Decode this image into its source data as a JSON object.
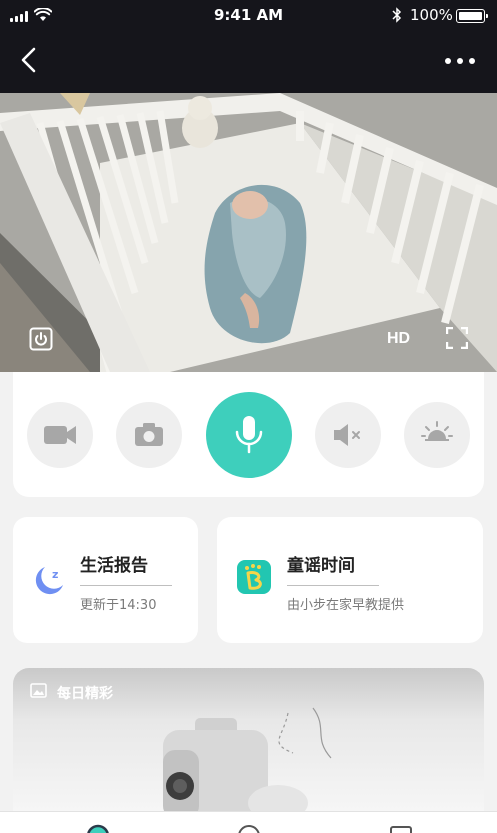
{
  "status_bar": {
    "time": "9:41 AM",
    "battery_text": "100%",
    "battery_level": 1.0,
    "icons": [
      "signal-icon",
      "wifi-icon",
      "bluetooth-icon",
      "battery-icon"
    ]
  },
  "nav": {
    "back_icon": "chevron-left-icon",
    "more_icon": "more-dots-icon"
  },
  "feed": {
    "quality_label": "HD",
    "icons": [
      "power-icon",
      "fullscreen-icon"
    ]
  },
  "controls": {
    "buttons": [
      "video-record-icon",
      "camera-icon",
      "microphone-icon",
      "speaker-mute-icon",
      "brightness-icon"
    ],
    "accent_color": "#3ecfbc"
  },
  "cards": {
    "life_report": {
      "title": "生活报告",
      "subtitle": "更新于14:30",
      "icon": "moon-sleep-icon"
    },
    "nursery_rhymes": {
      "title": "童谣时间",
      "subtitle": "由小步在家早教提供",
      "icon": "rhyme-app-icon"
    }
  },
  "daily": {
    "label": "每日精彩",
    "icon": "image-icon"
  },
  "tabbar": {
    "tabs": [
      "home-tab-icon",
      "discover-tab-icon",
      "profile-tab-icon"
    ]
  }
}
